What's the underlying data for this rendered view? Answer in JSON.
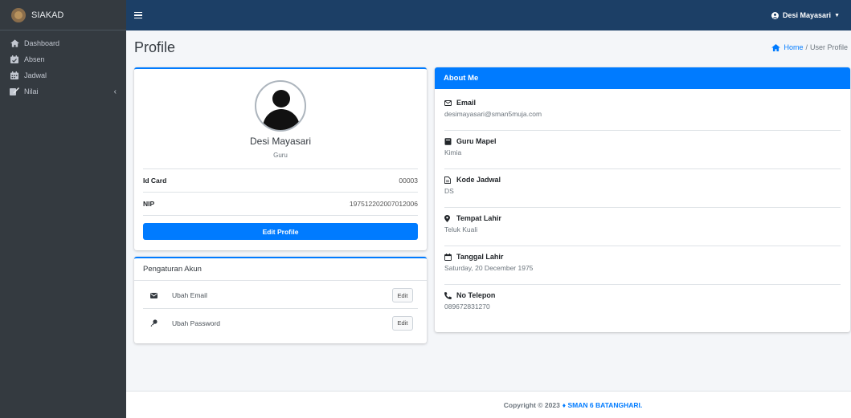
{
  "brand": {
    "name": "SIAKAD"
  },
  "sidebar": {
    "items": [
      {
        "label": "Dashboard",
        "icon": "home-icon"
      },
      {
        "label": "Absen",
        "icon": "calendar-check-icon"
      },
      {
        "label": "Jadwal",
        "icon": "calendar-icon"
      },
      {
        "label": "Nilai",
        "icon": "edit-icon"
      }
    ]
  },
  "topbar": {
    "user_name": "Desi Mayasari"
  },
  "page": {
    "title": "Profile"
  },
  "breadcrumb": {
    "home": "Home",
    "separator": "/",
    "current": "User Profile"
  },
  "profile": {
    "name": "Desi Mayasari",
    "role": "Guru",
    "rows": [
      {
        "label": "Id Card",
        "value": "00003"
      },
      {
        "label": "NIP",
        "value": "197512202007012006"
      }
    ],
    "edit_button": "Edit Profile"
  },
  "account": {
    "title": "Pengaturan Akun",
    "rows": [
      {
        "label": "Ubah Email",
        "button": "Edit",
        "icon": "envelope-icon"
      },
      {
        "label": "Ubah Password",
        "button": "Edit",
        "icon": "key-icon"
      }
    ]
  },
  "about": {
    "title": "About Me",
    "items": [
      {
        "label": "Email",
        "value": "desimayasari@sman5muja.com",
        "icon": "envelope-outline-icon"
      },
      {
        "label": "Guru Mapel",
        "value": "Kimia",
        "icon": "book-icon"
      },
      {
        "label": "Kode Jadwal",
        "value": "DS",
        "icon": "file-icon"
      },
      {
        "label": "Tempat Lahir",
        "value": "Teluk Kuali",
        "icon": "map-marker-icon"
      },
      {
        "label": "Tanggal Lahir",
        "value": "Saturday, 20 December 1975",
        "icon": "calendar-outline-icon"
      },
      {
        "label": "No Telepon",
        "value": "089672831270",
        "icon": "phone-icon"
      }
    ]
  },
  "footer": {
    "text": "Copyright © 2023",
    "link": "♦ SMAN 6 BATANGHARI."
  },
  "colors": {
    "primary": "#007bff",
    "topbar": "#1c3f66",
    "sidebar": "#343a40"
  }
}
